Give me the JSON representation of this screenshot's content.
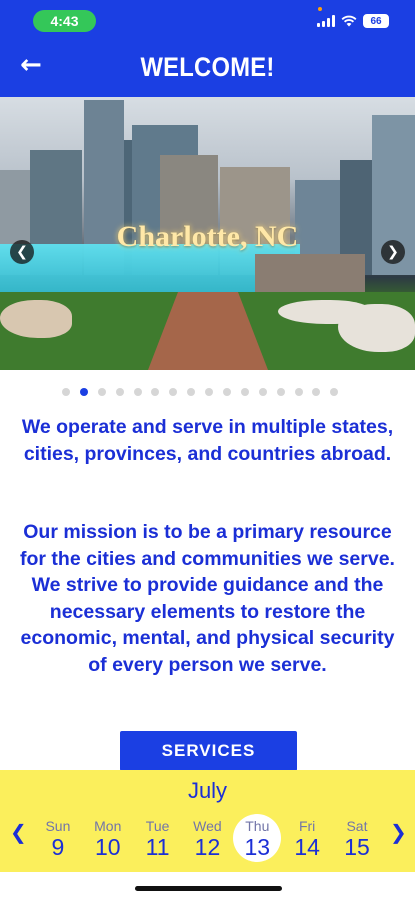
{
  "status_bar": {
    "time": "4:43",
    "battery": "66"
  },
  "header": {
    "title": "WELCOME!",
    "back_icon": "arrow-left-icon"
  },
  "hero": {
    "caption": "Charlotte, NC",
    "slide_count": 16,
    "active_index": 1
  },
  "intro_text": "We operate and serve in multiple states, cities, provinces, and countries abroad.",
  "mission_text": "Our mission is to be a primary resource for the cities and communities we serve. We strive to provide guidance and the necessary elements to restore the economic, mental, and physical security of every person we serve.",
  "services_button": "SERVICES",
  "calendar": {
    "month": "July",
    "days": [
      {
        "name": "Sun",
        "num": "9"
      },
      {
        "name": "Mon",
        "num": "10"
      },
      {
        "name": "Tue",
        "num": "11"
      },
      {
        "name": "Wed",
        "num": "12"
      },
      {
        "name": "Thu",
        "num": "13"
      },
      {
        "name": "Fri",
        "num": "14"
      },
      {
        "name": "Sat",
        "num": "15"
      }
    ],
    "selected_index": 4
  },
  "colors": {
    "primary": "#1b3fe3",
    "calendar_bg": "#fbef5c",
    "status_pill": "#34c759"
  }
}
